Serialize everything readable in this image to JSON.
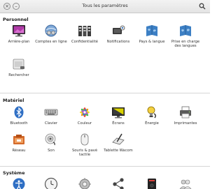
{
  "window": {
    "title": "Tous les paramètres",
    "close_glyph": "×",
    "minimize_glyph": "–"
  },
  "sections": {
    "personal": {
      "title": "Personnel",
      "items": [
        {
          "label": "Arrière-plan",
          "icon": "wallpaper-icon"
        },
        {
          "label": "Comptes en ligne",
          "icon": "online-accounts-icon"
        },
        {
          "label": "Confidentialité",
          "icon": "privacy-icon"
        },
        {
          "label": "Notifications",
          "icon": "notifications-icon"
        },
        {
          "label": "Pays & langue",
          "icon": "region-language-icon"
        },
        {
          "label": "Prise en charge des langues",
          "icon": "language-support-icon"
        },
        {
          "label": "Rechercher",
          "icon": "search-settings-icon"
        }
      ]
    },
    "hardware": {
      "title": "Matériel",
      "items": [
        {
          "label": "Bluetooth",
          "icon": "bluetooth-icon"
        },
        {
          "label": "Clavier",
          "icon": "keyboard-icon"
        },
        {
          "label": "Couleur",
          "icon": "color-icon"
        },
        {
          "label": "Écrans",
          "icon": "displays-icon"
        },
        {
          "label": "Énergie",
          "icon": "power-icon"
        },
        {
          "label": "Imprimantes",
          "icon": "printer-icon"
        },
        {
          "label": "Réseau",
          "icon": "network-icon"
        },
        {
          "label": "Son",
          "icon": "sound-icon"
        },
        {
          "label": "Souris & pavé tactile",
          "icon": "mouse-touchpad-icon"
        },
        {
          "label": "Tablette Wacom",
          "icon": "wacom-tablet-icon"
        }
      ]
    },
    "system": {
      "title": "Système",
      "items": [
        {
          "icon": "accessibility-icon"
        },
        {
          "icon": "date-time-icon"
        },
        {
          "icon": "details-icon"
        },
        {
          "icon": "sharing-icon"
        },
        {
          "icon": "backups-icon"
        },
        {
          "icon": "users-icon"
        }
      ]
    }
  }
}
